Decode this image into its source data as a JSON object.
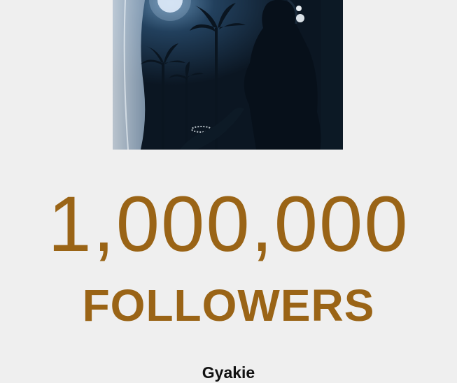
{
  "milestone": {
    "count": "1,000,000",
    "label": "FOLLOWERS",
    "artist": "Gyakie"
  },
  "colors": {
    "accent": "#9a6416",
    "background": "#efefef",
    "artist_text": "#111111"
  }
}
